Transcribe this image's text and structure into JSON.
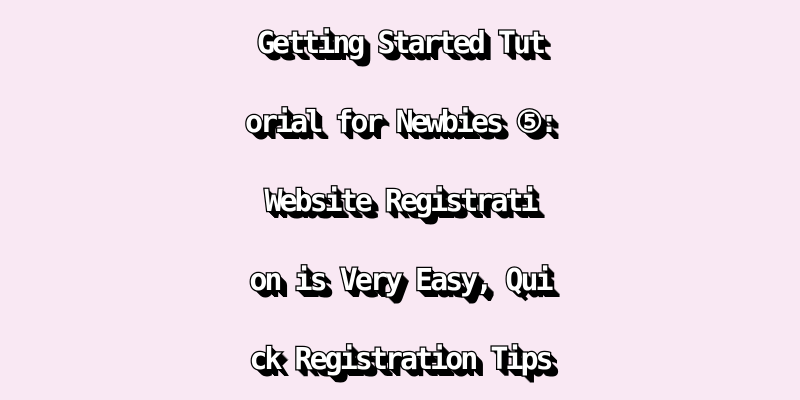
{
  "title": {
    "lines": [
      "Getting Started Tut",
      "orial for Newbies ⑤:",
      " Website Registrati",
      "on is Very Easy, Qui",
      "ck Registration Tips"
    ]
  },
  "colors": {
    "background": "#f9e8f3",
    "text_fill": "#ffffff",
    "text_outline": "#000000"
  }
}
